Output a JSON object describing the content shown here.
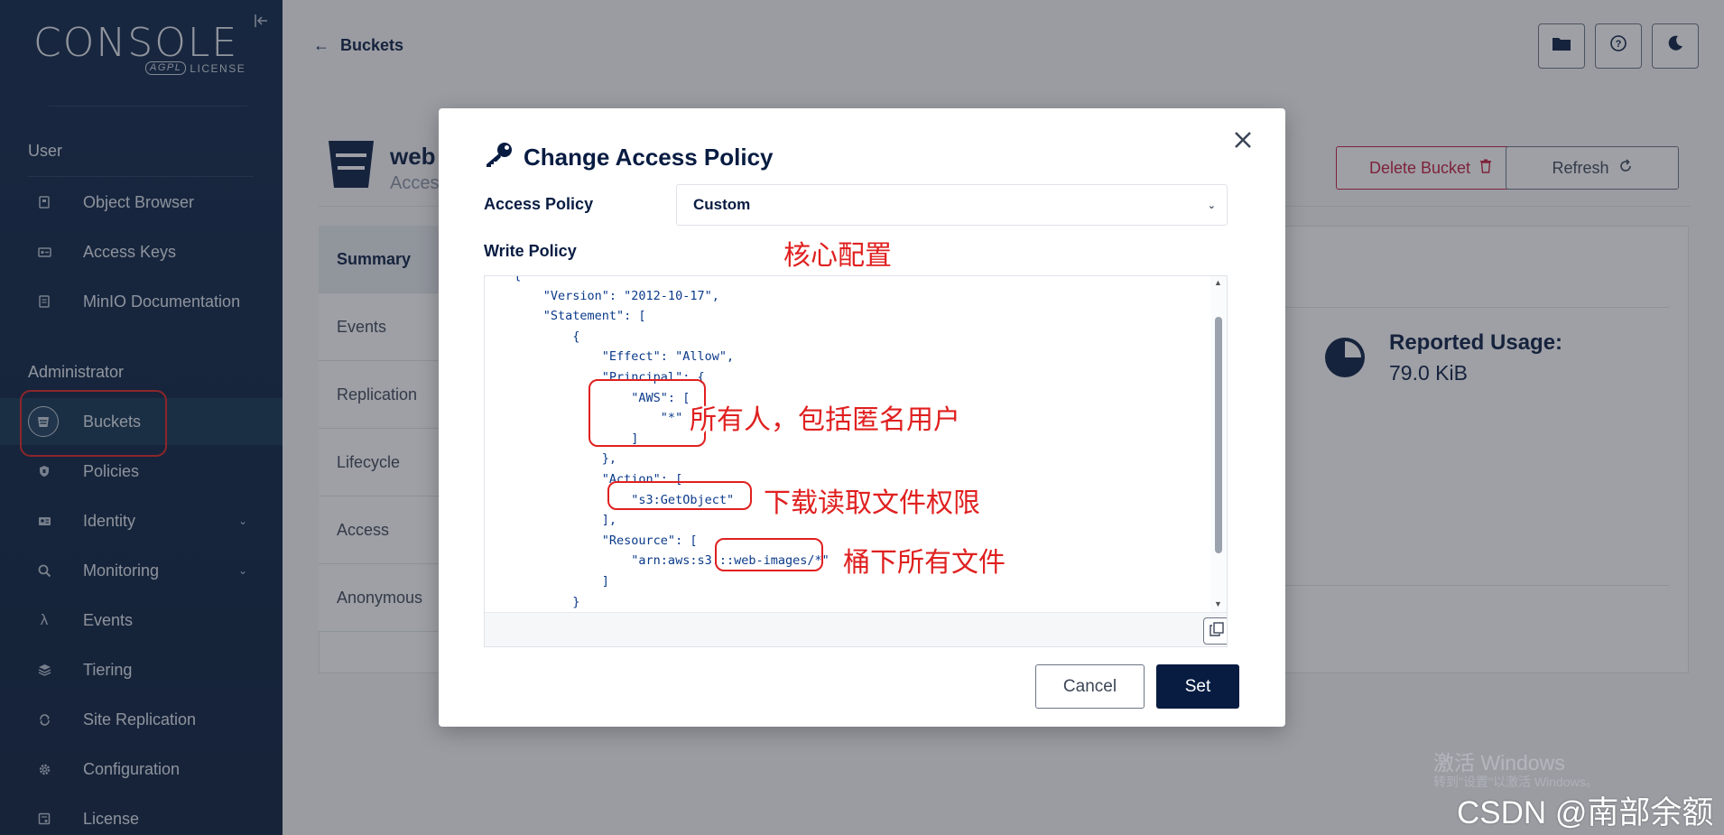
{
  "sidebar": {
    "logo": "CONSOLE",
    "logo_badge": "AGPL",
    "logo_license": "LICENSE",
    "sections": {
      "user": "User",
      "admin": "Administrator"
    },
    "user_items": [
      {
        "label": "Object Browser",
        "icon": "object-browser-icon"
      },
      {
        "label": "Access Keys",
        "icon": "access-keys-icon"
      },
      {
        "label": "MinIO Documentation",
        "icon": "documentation-icon"
      }
    ],
    "admin_items": [
      {
        "label": "Buckets",
        "icon": "buckets-icon"
      },
      {
        "label": "Policies",
        "icon": "policies-icon"
      },
      {
        "label": "Identity",
        "icon": "identity-icon"
      },
      {
        "label": "Monitoring",
        "icon": "monitoring-icon"
      },
      {
        "label": "Events",
        "icon": "events-icon"
      },
      {
        "label": "Tiering",
        "icon": "tiering-icon"
      },
      {
        "label": "Site Replication",
        "icon": "site-replication-icon"
      },
      {
        "label": "Configuration",
        "icon": "configuration-icon"
      },
      {
        "label": "License",
        "icon": "license-icon"
      }
    ]
  },
  "header": {
    "breadcrumb": "Buckets"
  },
  "bucket": {
    "title": "web",
    "subtitle": "Acces",
    "delete_label": "Delete Bucket",
    "refresh_label": "Refresh"
  },
  "tabs": [
    "Summary",
    "Events",
    "Replication",
    "Lifecycle",
    "Access",
    "Anonymous"
  ],
  "usage": {
    "label": "Reported Usage:",
    "value": "79.0 KiB"
  },
  "modal": {
    "title": "Change Access Policy",
    "access_policy_label": "Access Policy",
    "access_policy_value": "Custom",
    "write_policy_label": "Write Policy",
    "code_lines": [
      "  {",
      "      \"Version\": \"2012-10-17\",",
      "      \"Statement\": [",
      "          {",
      "              \"Effect\": \"Allow\",",
      "              \"Principal\": {",
      "                  \"AWS\": [",
      "                      \"*\"",
      "                  ]",
      "              },",
      "              \"Action\": [",
      "                  \"s3:GetObject\"",
      "              ],",
      "              \"Resource\": [",
      "                  \"arn:aws:s3:::web-images/*\"",
      "              ]",
      "          }",
      "      ]"
    ],
    "cancel_label": "Cancel",
    "set_label": "Set"
  },
  "annotations": {
    "core": "核心配置",
    "principal": "所有人，包括匿名用户",
    "action": "下载读取文件权限",
    "resource": "桶下所有文件"
  },
  "watermark": {
    "windows": "激活 Windows",
    "windows_sub": "转到\"设置\"以激活 Windows。",
    "csdn": "CSDN @南部余额"
  }
}
